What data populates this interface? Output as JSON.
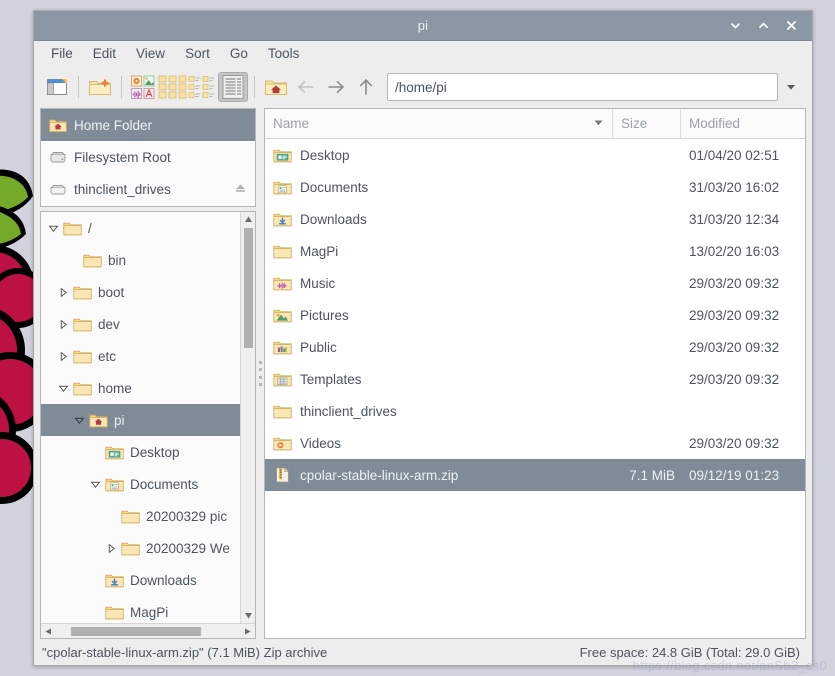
{
  "window": {
    "title": "pi",
    "buttons": [
      {
        "name": "minimize-button",
        "icon": "chevron-down-icon"
      },
      {
        "name": "maximize-button",
        "icon": "chevron-up-icon"
      },
      {
        "name": "close-button",
        "icon": "close-icon"
      }
    ]
  },
  "menubar": {
    "items": [
      {
        "label": "File",
        "name": "menu-file"
      },
      {
        "label": "Edit",
        "name": "menu-edit"
      },
      {
        "label": "View",
        "name": "menu-view"
      },
      {
        "label": "Sort",
        "name": "menu-sort"
      },
      {
        "label": "Go",
        "name": "menu-go"
      },
      {
        "label": "Tools",
        "name": "menu-tools"
      }
    ]
  },
  "toolbar": {
    "sidebar_toggle": "show-sidebar-icon",
    "new_folder": "new-folder-icon",
    "view_thumbnail": "thumbnail-view-icon",
    "view_icon": "icon-view-icon",
    "view_compact": "compact-view-icon",
    "view_detailed": "detailed-list-view-icon",
    "home": "home-folder-icon",
    "back": "back-arrow-icon",
    "forward": "forward-arrow-icon",
    "up": "up-arrow-icon",
    "path_value": "/home/pi",
    "path_placeholder": "/home/pi",
    "path_dropdown": "chevron-down-icon"
  },
  "places": {
    "items": [
      {
        "label": "Home Folder",
        "icon": "home-folder-icon",
        "selected": true
      },
      {
        "label": "Filesystem Root",
        "icon": "drive-harddisk-icon",
        "selected": false
      },
      {
        "label": "thinclient_drives",
        "icon": "drive-removable-icon",
        "selected": false,
        "eject": "eject-icon"
      }
    ]
  },
  "tree": {
    "items": [
      {
        "label": "/",
        "indent": 0,
        "twisty": "expanded",
        "icon": "folder-icon",
        "selected": false
      },
      {
        "label": "bin",
        "indent": 1,
        "twisty": "none",
        "icon": "folder-icon",
        "selected": false
      },
      {
        "label": "boot",
        "indent": 1,
        "twisty": "collapsed",
        "icon": "folder-icon",
        "selected": false
      },
      {
        "label": "dev",
        "indent": 1,
        "twisty": "collapsed",
        "icon": "folder-icon",
        "selected": false
      },
      {
        "label": "etc",
        "indent": 1,
        "twisty": "collapsed",
        "icon": "folder-icon",
        "selected": false
      },
      {
        "label": "home",
        "indent": 1,
        "twisty": "expanded",
        "icon": "folder-icon",
        "selected": false
      },
      {
        "label": "pi",
        "indent": 2,
        "twisty": "expanded",
        "icon": "home-folder-icon",
        "selected": true
      },
      {
        "label": "Desktop",
        "indent": 3,
        "twisty": "none",
        "icon": "folder-desktop-icon",
        "selected": false
      },
      {
        "label": "Documents",
        "indent": 3,
        "twisty": "expanded",
        "icon": "folder-documents-icon",
        "selected": false
      },
      {
        "label": "20200329 pic",
        "indent": 4,
        "twisty": "none",
        "icon": "folder-icon",
        "selected": false
      },
      {
        "label": "20200329 We",
        "indent": 4,
        "twisty": "collapsed",
        "icon": "folder-icon",
        "selected": false
      },
      {
        "label": "Downloads",
        "indent": 3,
        "twisty": "none",
        "icon": "folder-downloads-icon",
        "selected": false
      },
      {
        "label": "MagPi",
        "indent": 3,
        "twisty": "none",
        "icon": "folder-icon",
        "selected": false
      }
    ]
  },
  "filelist": {
    "columns": [
      {
        "label": "Name",
        "name": "column-name",
        "sort": "sort-descending-icon"
      },
      {
        "label": "Size",
        "name": "column-size"
      },
      {
        "label": "Modified",
        "name": "column-modified"
      }
    ],
    "rows": [
      {
        "name": "Desktop",
        "size": "",
        "modified": "01/04/20 02:51",
        "icon": "folder-desktop-icon",
        "selected": false
      },
      {
        "name": "Documents",
        "size": "",
        "modified": "31/03/20 16:02",
        "icon": "folder-documents-icon",
        "selected": false
      },
      {
        "name": "Downloads",
        "size": "",
        "modified": "31/03/20 12:34",
        "icon": "folder-downloads-icon",
        "selected": false
      },
      {
        "name": "MagPi",
        "size": "",
        "modified": "13/02/20 16:03",
        "icon": "folder-icon",
        "selected": false
      },
      {
        "name": "Music",
        "size": "",
        "modified": "29/03/20 09:32",
        "icon": "folder-music-icon",
        "selected": false
      },
      {
        "name": "Pictures",
        "size": "",
        "modified": "29/03/20 09:32",
        "icon": "folder-pictures-icon",
        "selected": false
      },
      {
        "name": "Public",
        "size": "",
        "modified": "29/03/20 09:32",
        "icon": "folder-public-icon",
        "selected": false
      },
      {
        "name": "Templates",
        "size": "",
        "modified": "29/03/20 09:32",
        "icon": "folder-templates-icon",
        "selected": false
      },
      {
        "name": "thinclient_drives",
        "size": "",
        "modified": "",
        "icon": "folder-icon",
        "selected": false
      },
      {
        "name": "Videos",
        "size": "",
        "modified": "29/03/20 09:32",
        "icon": "folder-videos-icon",
        "selected": false
      },
      {
        "name": "cpolar-stable-linux-arm.zip",
        "size": "7.1 MiB",
        "modified": "09/12/19 01:23",
        "icon": "zip-archive-icon",
        "selected": true
      }
    ]
  },
  "statusbar": {
    "selection": "\"cpolar-stable-linux-arm.zip\" (7.1 MiB) Zip archive",
    "free_space": "Free space: 24.8 GiB (Total: 29.0 GiB)"
  },
  "watermark": {
    "text": "https://blog.csdn.net/anSb2_cs0"
  },
  "colors": {
    "titlebar": "#8b97a2",
    "selection": "#7f8b96",
    "chrome": "#ededed",
    "folder": "#f5deA0",
    "desktop": "#d2d2de"
  }
}
